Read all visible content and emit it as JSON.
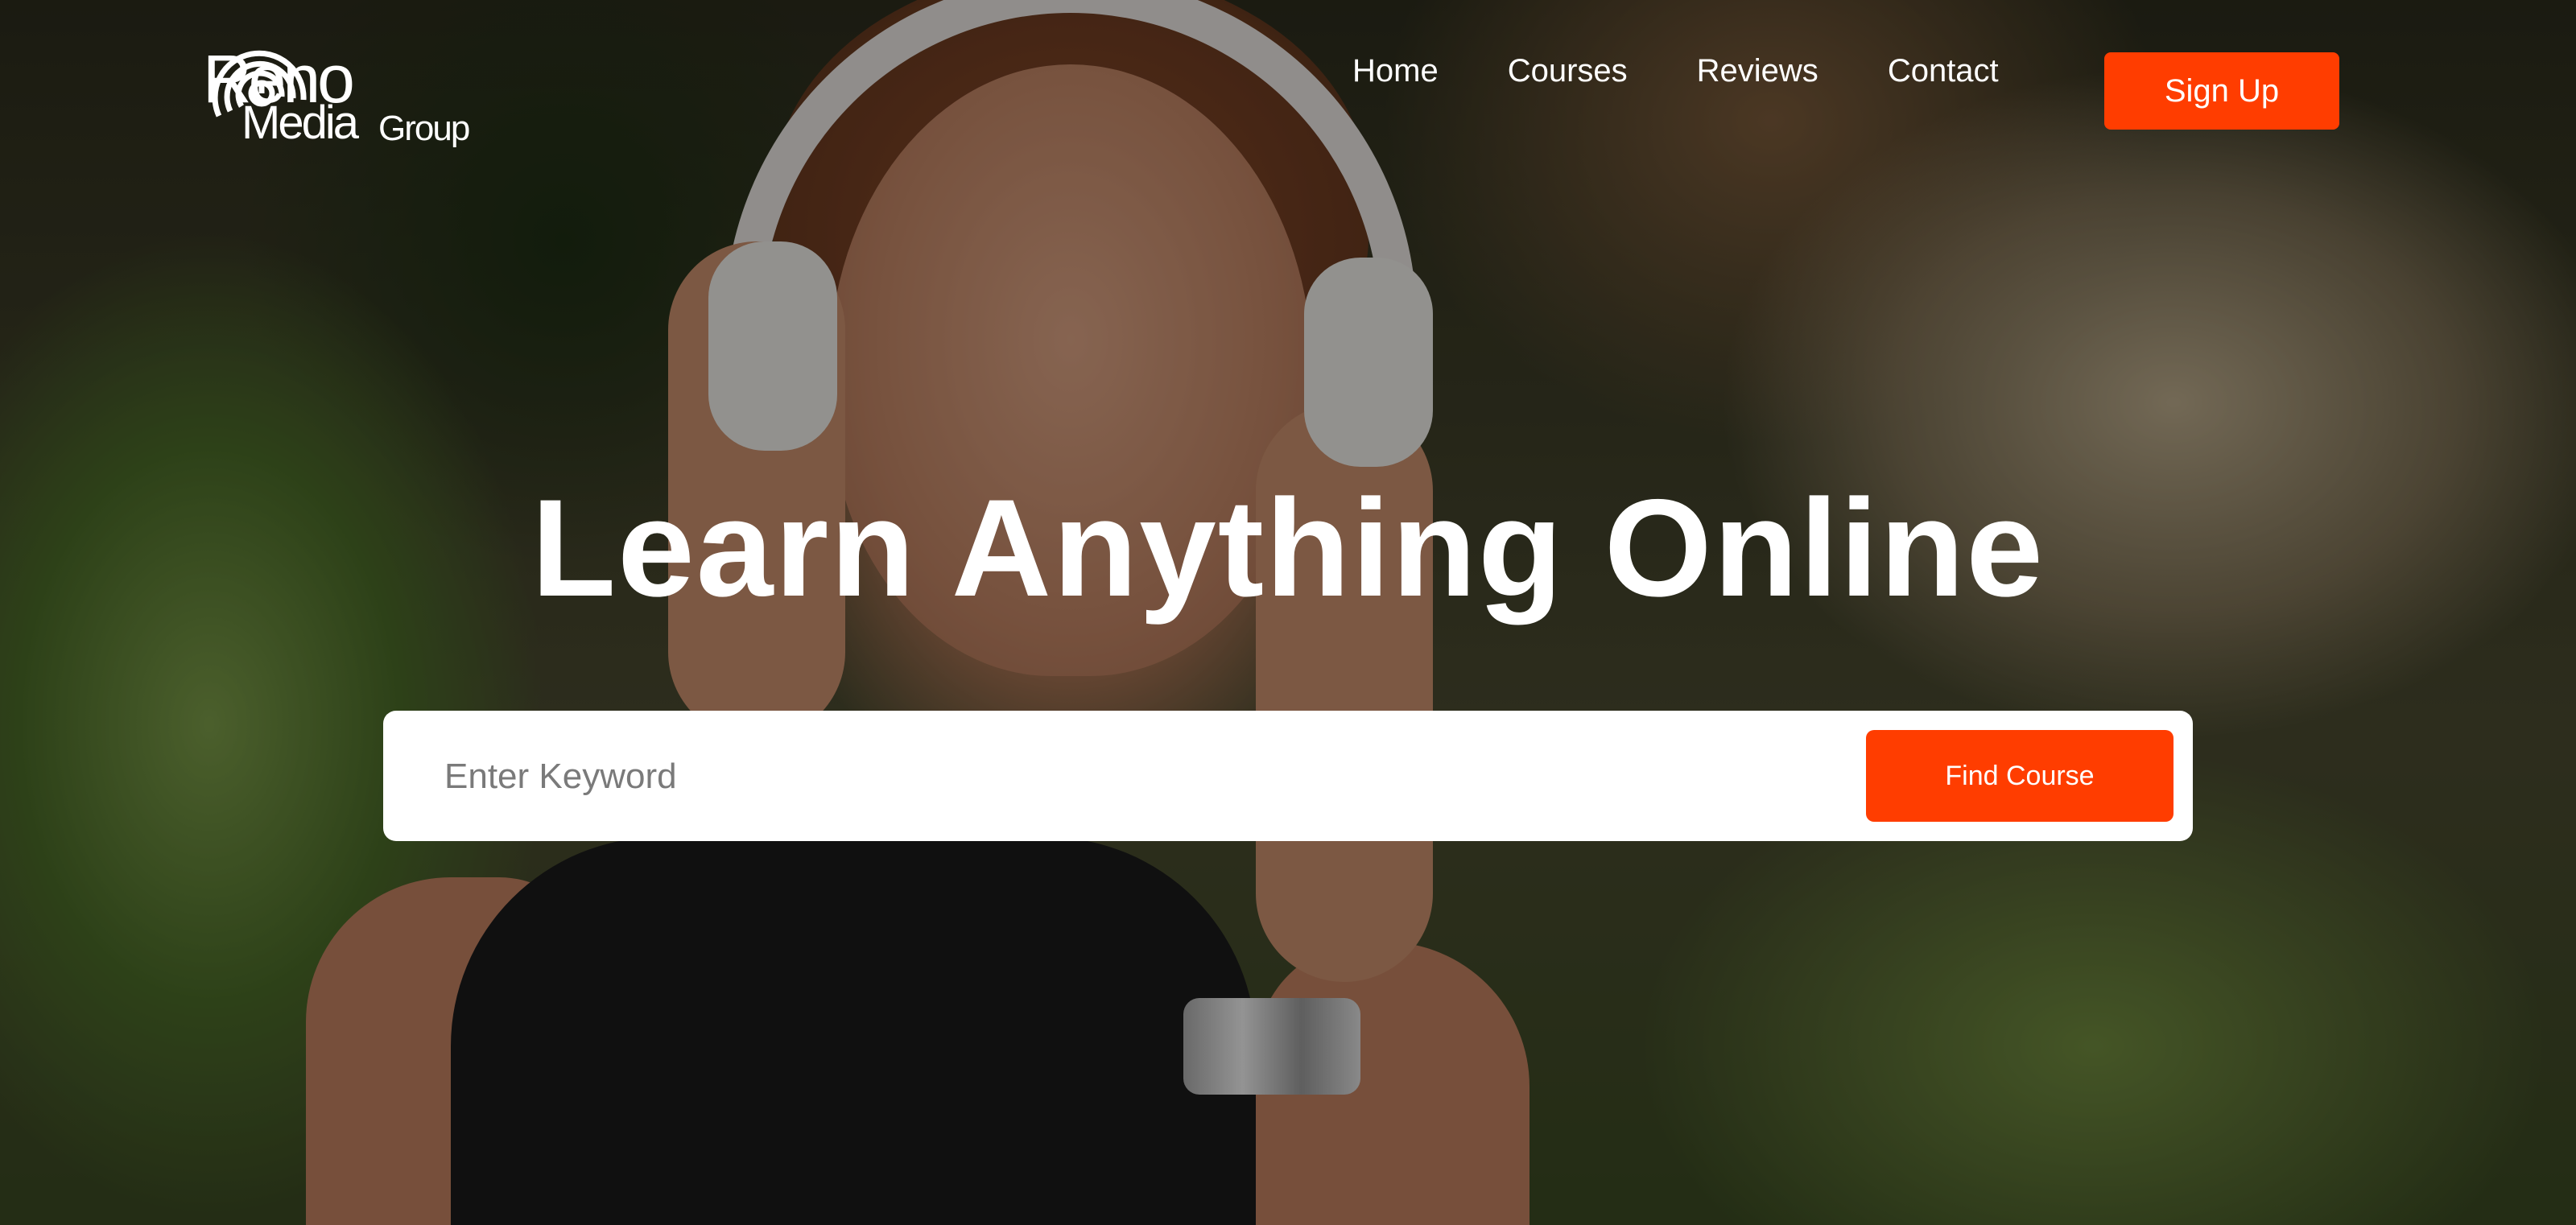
{
  "brand": {
    "logo_line1": "Reno",
    "logo_line2": "Media",
    "logo_line3": "Group"
  },
  "nav": {
    "items": [
      {
        "label": "Home"
      },
      {
        "label": "Courses"
      },
      {
        "label": "Reviews"
      },
      {
        "label": "Contact"
      }
    ],
    "cta_label": "Sign Up"
  },
  "hero": {
    "headline": "Learn Anything Online",
    "search_placeholder": "Enter Keyword",
    "search_value": "",
    "search_button_label": "Find Course"
  },
  "colors": {
    "accent": "#ff3d00",
    "text_on_dark": "#ffffff"
  },
  "icons": {
    "logo_mark": "sound-wave-rings-icon"
  }
}
